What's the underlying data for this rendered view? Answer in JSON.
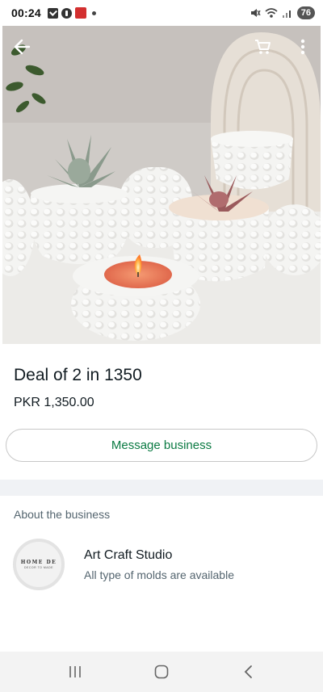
{
  "status_bar": {
    "time": "00:24",
    "battery": "76"
  },
  "product": {
    "title": "Deal of 2 in 1350",
    "price": "PKR 1,350.00",
    "image_alt": "Dimpled white planter pots with succulents and a lit tealight candle holder"
  },
  "actions": {
    "message_business": "Message business"
  },
  "about": {
    "heading": "About the business",
    "business_name": "Art Craft Studio",
    "business_description": "All type of molds are available",
    "avatar_text": "HOME DE",
    "avatar_subtext": "DECOR TO MADE"
  },
  "icons": {
    "back": "arrow-left-icon",
    "cart": "cart-icon",
    "more": "more-vertical-icon",
    "nav_recents": "recents-icon",
    "nav_home": "home-icon",
    "nav_back": "back-chevron-icon"
  },
  "colors": {
    "accent_green": "#0b7a43",
    "divider": "#f0f2f5"
  }
}
